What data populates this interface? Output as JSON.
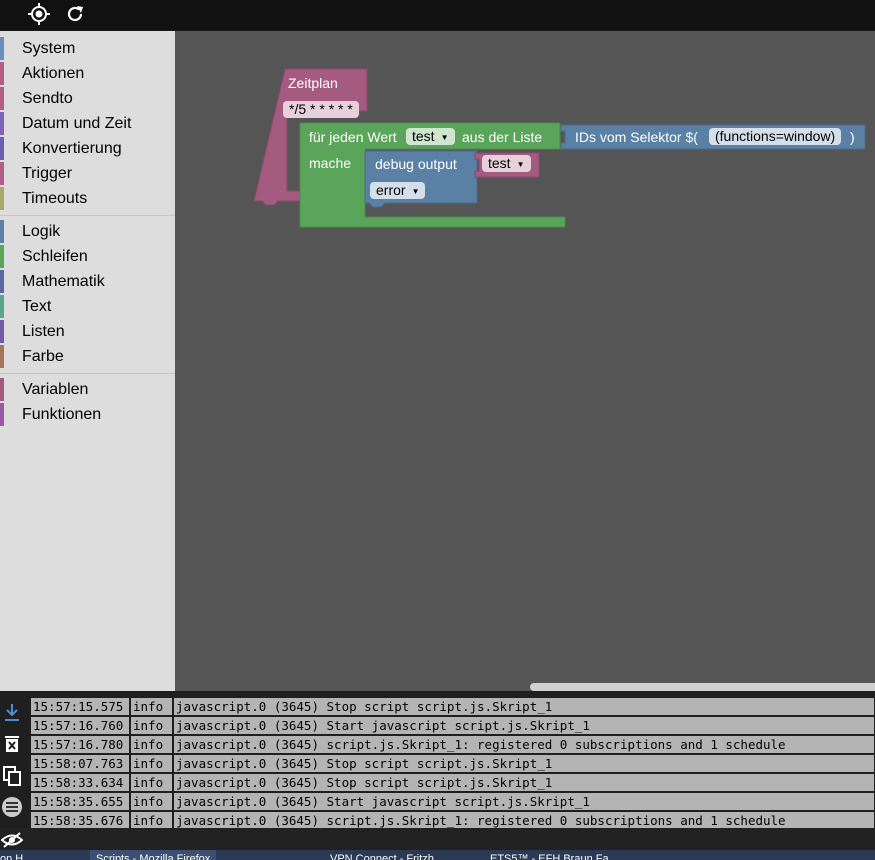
{
  "toolbar": {
    "locate_icon": "target-icon",
    "refresh_icon": "refresh-icon"
  },
  "toolbox": {
    "groups": [
      [
        {
          "label": "System",
          "color": "#6a8ec0"
        },
        {
          "label": "Aktionen",
          "color": "#b45b88"
        },
        {
          "label": "Sendto",
          "color": "#b45b88"
        },
        {
          "label": "Datum und Zeit",
          "color": "#7e63b8"
        },
        {
          "label": "Konvertierung",
          "color": "#6a5fb0"
        },
        {
          "label": "Trigger",
          "color": "#b45b88"
        },
        {
          "label": "Timeouts",
          "color": "#a8a86a"
        }
      ],
      [
        {
          "label": "Logik",
          "color": "#5c81a6"
        },
        {
          "label": "Schleifen",
          "color": "#5ba55b"
        },
        {
          "label": "Mathematik",
          "color": "#5b67a5"
        },
        {
          "label": "Text",
          "color": "#5ba58c"
        },
        {
          "label": "Listen",
          "color": "#745ba5"
        },
        {
          "label": "Farbe",
          "color": "#a5745b"
        }
      ],
      [
        {
          "label": "Variablen",
          "color": "#a55b80"
        },
        {
          "label": "Funktionen",
          "color": "#995ba5"
        }
      ]
    ]
  },
  "blocks": {
    "schedule": {
      "label": "Zeitplan",
      "cron": "*/5 * * * * *",
      "color": "#a55b80"
    },
    "foreach": {
      "label": "für jeden Wert",
      "var": "test",
      "in_label": "aus der Liste",
      "do_label": "mache",
      "color": "#5ba55b"
    },
    "selector": {
      "label": "IDs vom Selektor $(",
      "value": "(functions=window)",
      "close": ")",
      "color": "#5b80a5"
    },
    "debug": {
      "label": "debug output",
      "var": "test",
      "level": "error",
      "color": "#5b80a5"
    }
  },
  "log": {
    "icons": [
      "download-icon",
      "delete-icon",
      "copy-icon",
      "list-icon",
      "hide-icon"
    ],
    "rows": [
      {
        "time": "15:57:15.575",
        "severity": "info",
        "message": "javascript.0 (3645) Stop script script.js.Skript_1"
      },
      {
        "time": "15:57:16.760",
        "severity": "info",
        "message": "javascript.0 (3645) Start javascript script.js.Skript_1"
      },
      {
        "time": "15:57:16.780",
        "severity": "info",
        "message": "javascript.0 (3645) script.js.Skript_1: registered 0 subscriptions and 1 schedule"
      },
      {
        "time": "15:58:07.763",
        "severity": "info",
        "message": "javascript.0 (3645) Stop script script.js.Skript_1"
      },
      {
        "time": "15:58:33.634",
        "severity": "info",
        "message": "javascript.0 (3645) Stop script script.js.Skript_1"
      },
      {
        "time": "15:58:35.655",
        "severity": "info",
        "message": "javascript.0 (3645) Start javascript script.js.Skript_1"
      },
      {
        "time": "15:58:35.676",
        "severity": "info",
        "message": "javascript.0 (3645) script.js.Skript_1: registered 0 subscriptions and 1 schedule"
      }
    ]
  },
  "taskbar": {
    "items": [
      {
        "label": "on H"
      },
      {
        "label": "Scripts - Mozilla Firefox"
      },
      {
        "label": "VPN Connect - Fritzb..."
      },
      {
        "label": "ETS5™ - EFH Braun Fa..."
      }
    ]
  }
}
